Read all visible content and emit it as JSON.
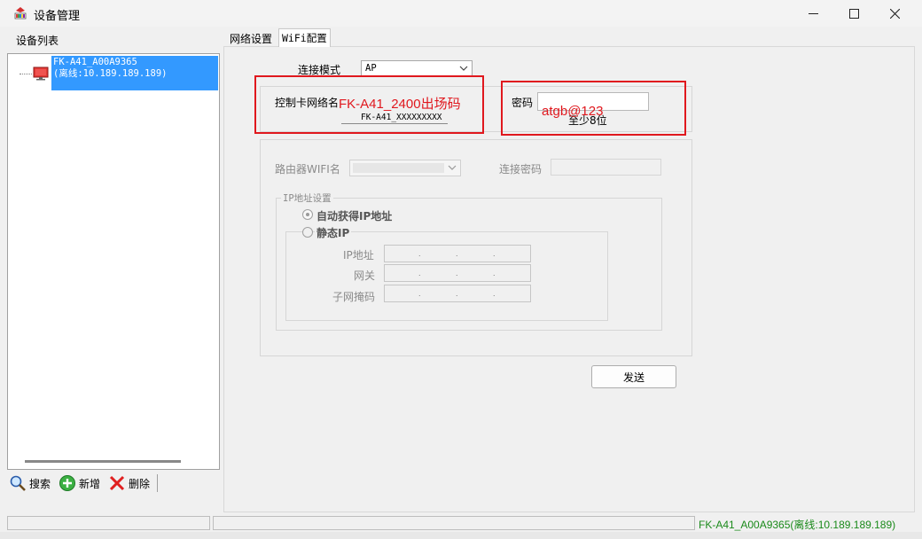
{
  "window": {
    "title": "设备管理"
  },
  "device_list": {
    "title": "设备列表",
    "items": [
      {
        "name": "FK-A41_A00A9365",
        "status": "(离线:10.189.189.189)"
      }
    ]
  },
  "toolbar": {
    "search": "搜索",
    "add": "新增",
    "delete": "删除"
  },
  "tabs": [
    {
      "label": "网络设置"
    },
    {
      "label": "WiFi配置"
    }
  ],
  "wifi": {
    "mode_label": "连接模式",
    "mode_value": "AP",
    "ssid_label": "控制卡网络名",
    "ssid_value": "FK-A41_XXXXXXXXX",
    "ssid_annotation": "FK-A41_2400出场码",
    "password_label": "密码",
    "password_hint": "至少8位",
    "password_annotation": "atgb@123",
    "router_label": "路由器WIFI名",
    "router_password_label": "连接密码",
    "ip_group_title": "IP地址设置",
    "auto_ip": "自动获得IP地址",
    "static_ip": "静态IP",
    "ip_address_label": "IP地址",
    "gateway_label": "网关",
    "subnet_label": "子网掩码",
    "send_label": "发送"
  },
  "status": {
    "text": "FK-A41_A00A9365(离线:10.189.189.189)"
  },
  "colors": {
    "selection": "#3399ff",
    "annotation_red": "#e0181e",
    "status_green": "#1a8a1a"
  }
}
